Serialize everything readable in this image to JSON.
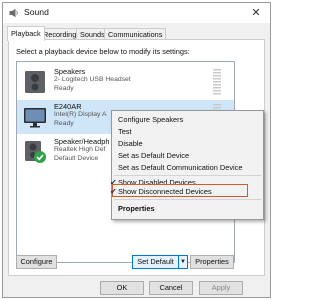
{
  "window": {
    "title": "Sound",
    "close_glyph": "✕"
  },
  "tabs": [
    {
      "label": "Playback"
    },
    {
      "label": "Recording"
    },
    {
      "label": "Sounds"
    },
    {
      "label": "Communications"
    }
  ],
  "instruction": "Select a playback device below to modify its settings:",
  "devices": [
    {
      "name": "Speakers",
      "sub": "2- Logitech USB Headset",
      "status": "Ready"
    },
    {
      "name": "E240AR",
      "sub": "Intel(R) Display A",
      "status": "Ready"
    },
    {
      "name": "Speaker/Headph",
      "sub": "Realtek High Def",
      "status": "Default Device"
    }
  ],
  "context_menu": {
    "items": [
      "Configure Speakers",
      "Test",
      "Disable",
      "Set as Default Device",
      "Set as Default Communication Device",
      "Show Disabled Devices",
      "Show Disconnected Devices",
      "Properties"
    ],
    "check_glyph": "✔"
  },
  "buttons": {
    "configure": "Configure",
    "set_default": "Set Default",
    "properties": "Properties",
    "ok": "OK",
    "cancel": "Cancel",
    "apply": "Apply"
  },
  "colors": {
    "selection": "#cfe5f8",
    "highlight_border": "#d35a2a",
    "default_check": "#2fa24a",
    "accent": "#0078d7"
  }
}
